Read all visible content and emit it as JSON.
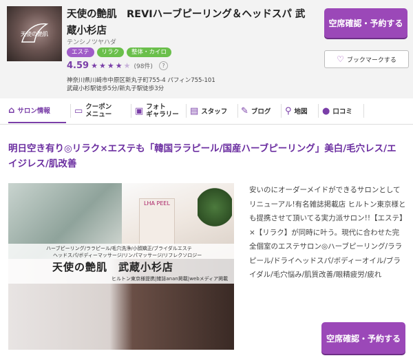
{
  "salon": {
    "logo_text": "天使の艶肌",
    "name": "天使の艶肌　REVIハーブピーリング＆ヘッドスパ 武蔵小杉店",
    "kana": "テンシノツヤハダ",
    "tags": [
      "エステ",
      "リラク",
      "整体・カイロ"
    ],
    "rating": "4.59",
    "review_count": "(98件)",
    "help": "?",
    "address_line1": "神奈川県川崎市中原区新丸子町755-4 パフィン755-101",
    "address_line2": "武蔵小杉駅徒歩5分/新丸子駅徒歩3分"
  },
  "actions": {
    "reserve_label": "空席確認・予約する",
    "bookmark_label": "ブックマークする"
  },
  "nav": {
    "items": [
      {
        "label": "サロン情報",
        "icon": "home-icon"
      },
      {
        "label": "クーポン\nメニュー",
        "icon": "coupon-icon"
      },
      {
        "label": "フォト\nギャラリー",
        "icon": "photo-icon"
      },
      {
        "label": "スタッフ",
        "icon": "staff-icon"
      },
      {
        "label": "ブログ",
        "icon": "pen-icon"
      },
      {
        "label": "地図",
        "icon": "map-pin-icon"
      },
      {
        "label": "口コミ",
        "icon": "chat-icon"
      }
    ]
  },
  "main": {
    "catch_copy": "明日空き有り◎リラク×エステも「韓国ララピール/国産ハーブピーリング」美白/毛穴レス/エイジレス/肌改善",
    "photo": {
      "peel_label": "LHA PEEL",
      "subtitle1": "ハーブピーリング/ララピール/毛穴洗浄/小顔矯正/ブライダルエステ",
      "subtitle2": "ヘッドスパ/ボディーマッサージ/リンパマッサージ/リフレクソロジー",
      "title": "天使の艶肌　武蔵小杉店",
      "subtitle3": "ヒルトン東京様提携|雑誌anan掲載|webメディア掲載"
    },
    "description": "安いのにオーダーメイドができるサロンとしてリニューアル!有名雑誌掲載店 ヒルトン東京様とも提携させて頂いてる実力派サロン!!【エステ】×【リラク】が同時に叶う。現代に合わせた完全個室のエステサロン◎ハーブピーリング/ララピール/ドライヘッドスパ/ボディーオイル/ブライダル/毛穴悩み/肌質改善/眼精疲労/疲れ"
  },
  "colors": {
    "accent": "#9b48b8",
    "brand_text": "#6b2ea0"
  }
}
